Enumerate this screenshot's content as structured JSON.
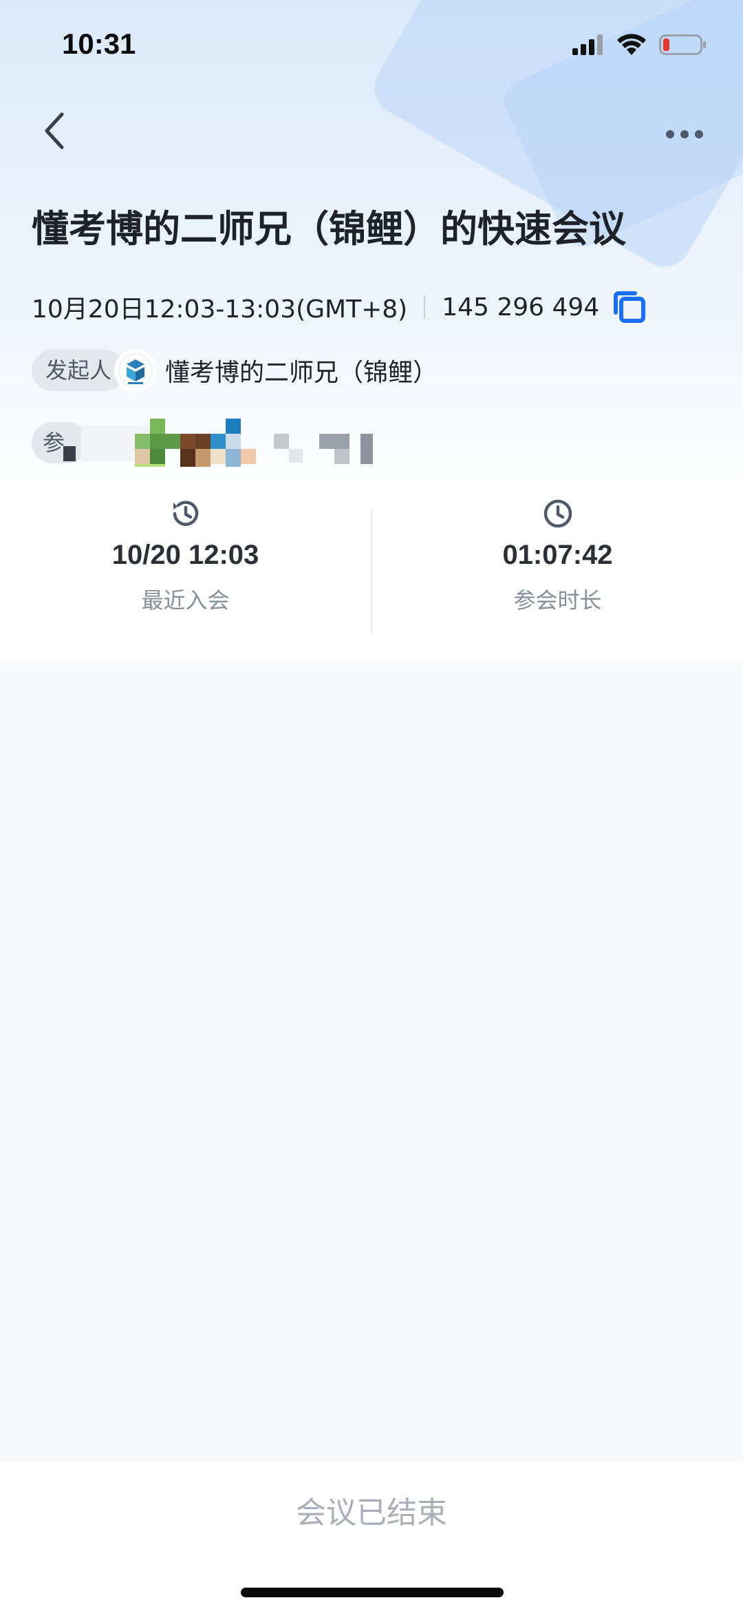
{
  "status_bar": {
    "time": "10:31",
    "icons": [
      "signal-icon",
      "wifi-icon",
      "battery-low-icon"
    ]
  },
  "nav": {
    "back_icon": "chevron-left-icon",
    "more_icon": "more-horizontal-icon"
  },
  "meeting": {
    "title": "懂考博的二师兄（锦鲤）的快速会议",
    "datetime": "10月20日12:03-13:03(GMT+8)",
    "meeting_id": "145 296 494",
    "copy_icon": "copy-icon"
  },
  "host": {
    "tag": "发起人",
    "name": "懂考博的二师兄（锦鲤）"
  },
  "participants": {
    "tag": "参"
  },
  "stats": {
    "recent_join": {
      "value": "10/20 12:03",
      "label": "最近入会",
      "icon": "history-clock-icon"
    },
    "duration": {
      "value": "01:07:42",
      "label": "参会时长",
      "icon": "clock-icon"
    }
  },
  "footer": {
    "status": "会议已结束"
  },
  "colors": {
    "accent": "#1a6ef5",
    "battery_low": "#e5362f"
  }
}
